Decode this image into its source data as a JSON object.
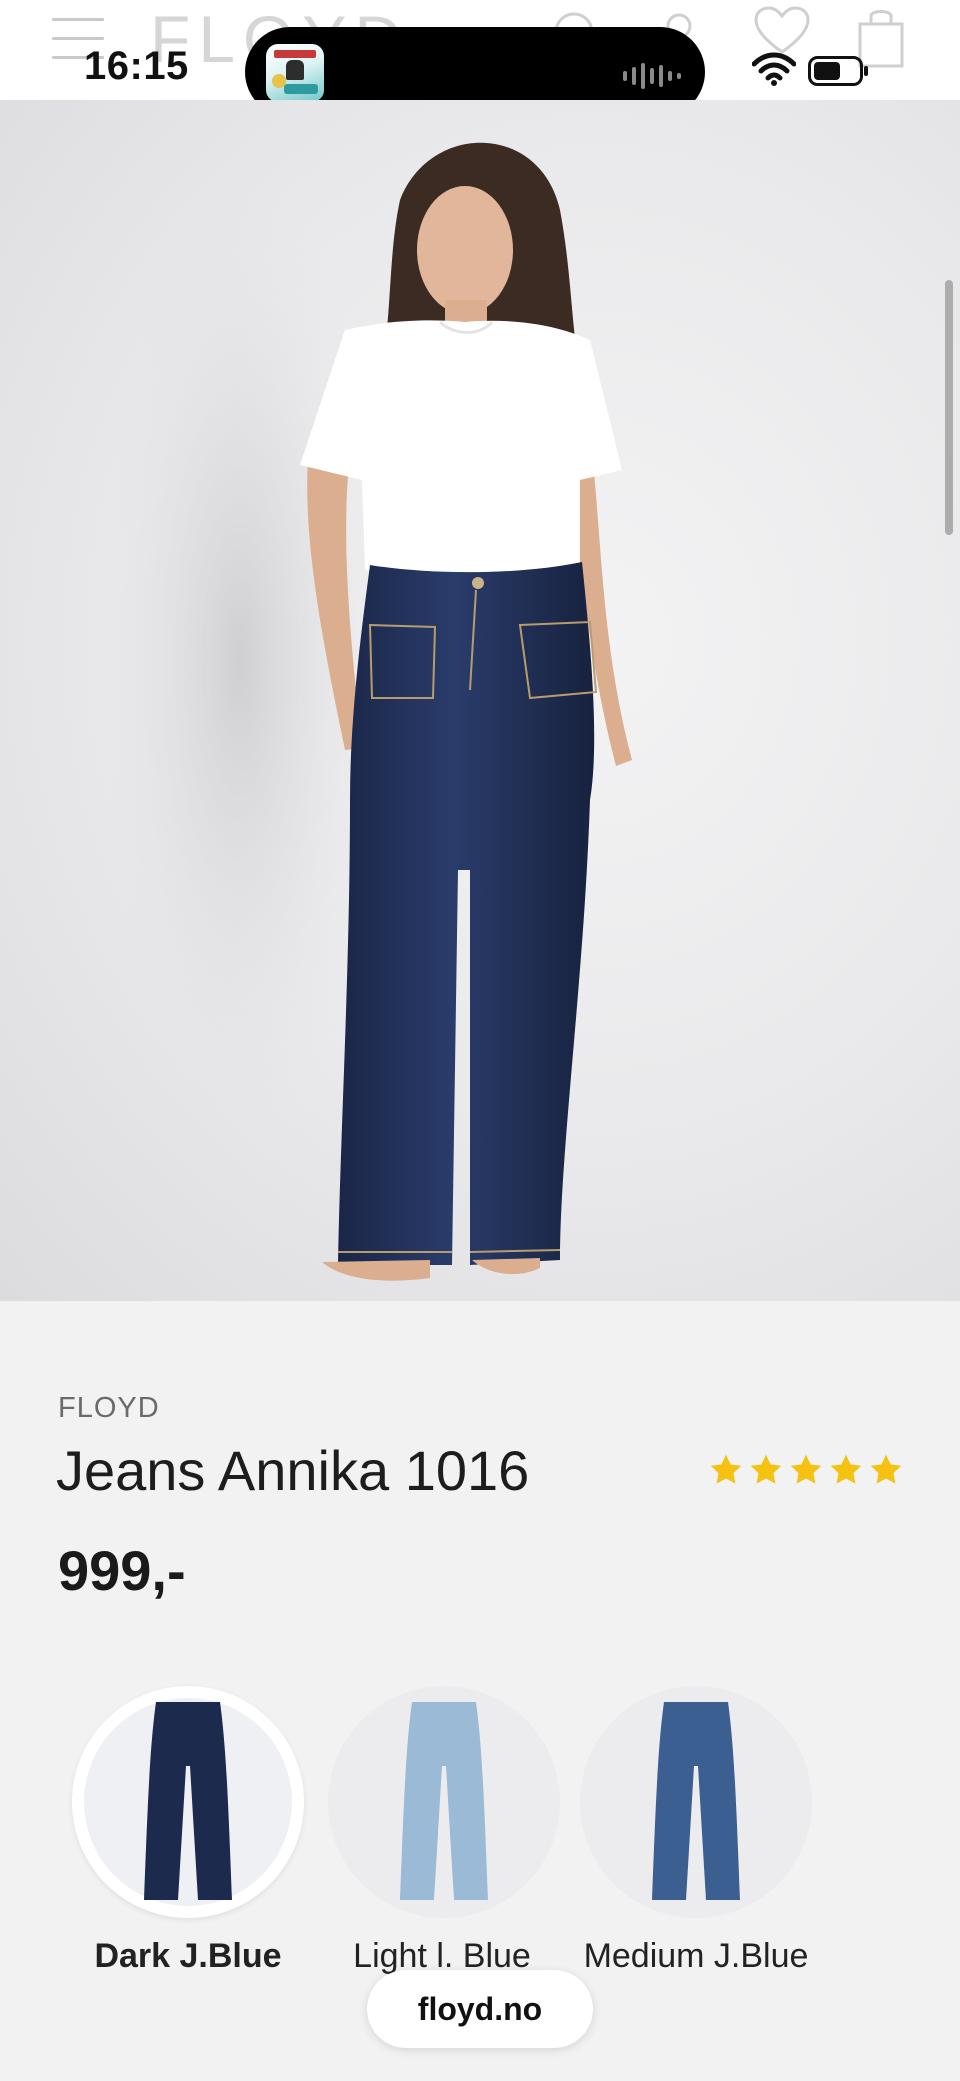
{
  "status_bar": {
    "time": "16:15"
  },
  "header": {
    "logo": "FLOYD"
  },
  "gallery": {
    "image_count": 5,
    "active_index": 3
  },
  "product": {
    "brand": "FLOYD",
    "title": "Jeans Annika 1016",
    "rating_stars": 5,
    "price": "999,-"
  },
  "variants": [
    {
      "label": "Dark J.Blue",
      "selected": true,
      "color": "#1c2a4e"
    },
    {
      "label": "Light l. Blue",
      "selected": false,
      "color": "#9bbad6"
    },
    {
      "label": "Medium J.Blue",
      "selected": false,
      "color": "#3c5f91"
    }
  ],
  "browser": {
    "url": "floyd.no"
  },
  "colors": {
    "star": "#f5c211",
    "denim_dark": "#1c2a4e",
    "background": "#f2f2f3"
  }
}
